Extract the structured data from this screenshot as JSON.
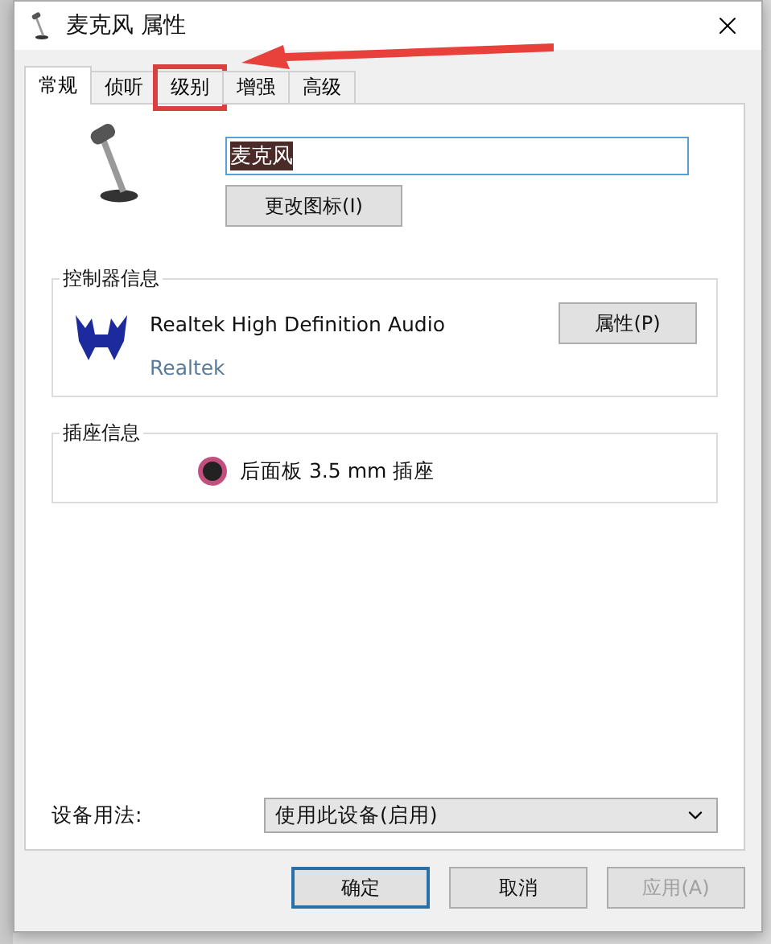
{
  "window": {
    "title": "麦克风 属性"
  },
  "tabs": [
    {
      "label": "常规",
      "selected": true,
      "highlighted": false
    },
    {
      "label": "侦听",
      "selected": false,
      "highlighted": false
    },
    {
      "label": "级别",
      "selected": false,
      "highlighted": true
    },
    {
      "label": "增强",
      "selected": false,
      "highlighted": false
    },
    {
      "label": "高级",
      "selected": false,
      "highlighted": false
    }
  ],
  "device": {
    "name": "麦克风",
    "change_icon_button": "更改图标(I)"
  },
  "controller": {
    "title": "控制器信息",
    "name": "Realtek High Definition Audio",
    "vendor": "Realtek",
    "button": "属性(P)"
  },
  "jack": {
    "title": "插座信息",
    "label": "后面板 3.5 mm 插座",
    "color": "#c2507e"
  },
  "usage": {
    "label": "设备用法:",
    "value": "使用此设备(启用)"
  },
  "buttons": [
    {
      "label": "确定",
      "kind": "default",
      "disabled": false
    },
    {
      "label": "取消",
      "kind": "normal",
      "disabled": false
    },
    {
      "label": "应用(A)",
      "kind": "normal",
      "disabled": true
    }
  ]
}
